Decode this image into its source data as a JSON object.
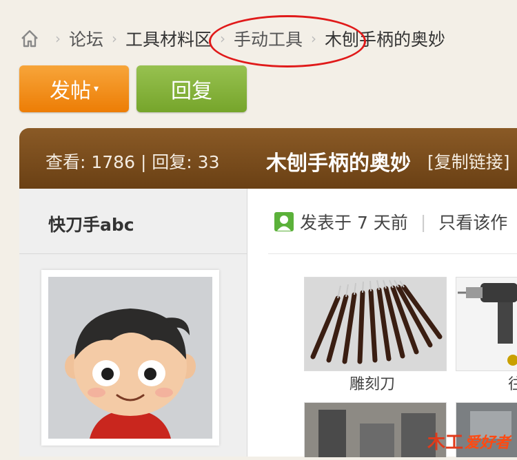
{
  "breadcrumb": {
    "home_icon": "home-icon",
    "items": [
      "论坛",
      "工具材料区",
      "手动工具",
      "木刨手柄的奥妙"
    ]
  },
  "toolbar": {
    "post_label": "发帖",
    "reply_label": "回复"
  },
  "thread": {
    "stats": "查看: 1786 | 回复: 33",
    "title": "木刨手柄的奥妙",
    "copy_link": "[复制链接]"
  },
  "author": {
    "name": "快刀手abc"
  },
  "post": {
    "posted": "发表于 7 天前",
    "only_author": "只看该作",
    "images": [
      {
        "label": "雕刻刀"
      },
      {
        "label": "往"
      }
    ]
  },
  "watermark": {
    "logo": "木工",
    "text": "爱好者"
  },
  "colors": {
    "post_button": "#ed7d05",
    "reply_button": "#76a52b",
    "title_bar": "#7a4c1c",
    "annotation": "#e01a1a"
  }
}
